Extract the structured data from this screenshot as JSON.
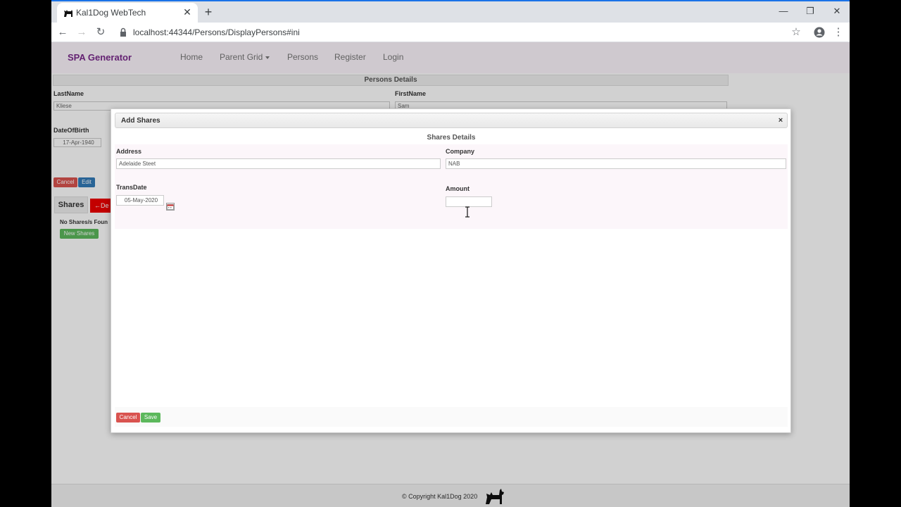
{
  "browser": {
    "tab_title": "Kal1Dog WebTech",
    "url": "localhost:44344/Persons/DisplayPersons#ini"
  },
  "app": {
    "brand": "SPA Generator",
    "nav": {
      "home": "Home",
      "parent_grid": "Parent Grid",
      "persons": "Persons",
      "register": "Register",
      "login": "Login"
    }
  },
  "persons": {
    "header": "Persons Details",
    "lastname_label": "LastName",
    "lastname_value": "Kliese",
    "firstname_label": "FirstName",
    "firstname_value": "Sam",
    "dob_label": "DateOfBirth",
    "dob_value": "17-Apr-1940",
    "cancel_label": "Cancel",
    "edit_label": "Edit"
  },
  "shares_panel": {
    "tab_label": "Shares",
    "delete_label": "←De",
    "empty_text": "No Shares/s Foun",
    "new_label": "New Shares"
  },
  "modal": {
    "title": "Add Shares",
    "close_glyph": "×",
    "section_title": "Shares Details",
    "address_label": "Address",
    "address_value": "Adelaide Steet",
    "company_label": "Company",
    "company_value": "NAB",
    "transdate_label": "TransDate",
    "transdate_value": "05-May-2020",
    "amount_label": "Amount",
    "amount_value": "",
    "cancel_label": "Cancel",
    "save_label": "Save"
  },
  "footer": {
    "copyright": "© Copyright Kal1Dog 2020"
  },
  "icons": {
    "tab_favicon": "dog-icon",
    "tab_close": "close-icon",
    "new_tab": "plus-icon",
    "back": "arrow-left-icon",
    "forward": "arrow-right-icon",
    "reload": "reload-icon",
    "lock": "lock-icon",
    "bookmark": "star-icon",
    "profile": "account-icon",
    "menu": "kebab-icon",
    "calendar": "calendar-icon",
    "footer_logo": "dog-icon"
  },
  "colors": {
    "brand": "#7a2a8c",
    "danger": "#d9534f",
    "primary": "#337ab7",
    "success": "#5cb85c",
    "chrome_accent": "#1a73e8"
  }
}
